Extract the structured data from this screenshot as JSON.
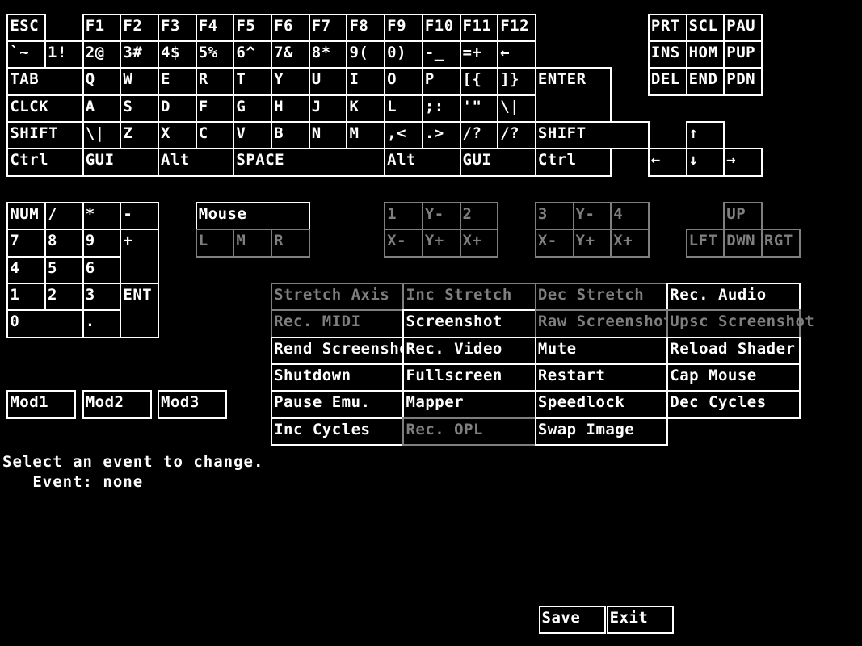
{
  "colors": {
    "enabled": "#FFFFFF",
    "disabled": "#7F7F7F",
    "background": "#000000"
  },
  "keyboard": {
    "keys": [
      {
        "label": "ESC",
        "c": 0,
        "r": 0,
        "w": 1,
        "h": 1
      },
      {
        "label": "F1",
        "c": 2,
        "r": 0,
        "w": 1,
        "h": 1
      },
      {
        "label": "F2",
        "c": 3,
        "r": 0,
        "w": 1,
        "h": 1
      },
      {
        "label": "F3",
        "c": 4,
        "r": 0,
        "w": 1,
        "h": 1
      },
      {
        "label": "F4",
        "c": 5,
        "r": 0,
        "w": 1,
        "h": 1
      },
      {
        "label": "F5",
        "c": 6,
        "r": 0,
        "w": 1,
        "h": 1
      },
      {
        "label": "F6",
        "c": 7,
        "r": 0,
        "w": 1,
        "h": 1
      },
      {
        "label": "F7",
        "c": 8,
        "r": 0,
        "w": 1,
        "h": 1
      },
      {
        "label": "F8",
        "c": 9,
        "r": 0,
        "w": 1,
        "h": 1
      },
      {
        "label": "F9",
        "c": 10,
        "r": 0,
        "w": 1,
        "h": 1
      },
      {
        "label": "F10",
        "c": 11,
        "r": 0,
        "w": 1,
        "h": 1
      },
      {
        "label": "F11",
        "c": 12,
        "r": 0,
        "w": 1,
        "h": 1
      },
      {
        "label": "F12",
        "c": 13,
        "r": 0,
        "w": 1,
        "h": 1
      },
      {
        "label": "`~",
        "c": 0,
        "r": 1,
        "w": 1,
        "h": 1
      },
      {
        "label": "1!",
        "c": 1,
        "r": 1,
        "w": 1,
        "h": 1
      },
      {
        "label": "2@",
        "c": 2,
        "r": 1,
        "w": 1,
        "h": 1
      },
      {
        "label": "3#",
        "c": 3,
        "r": 1,
        "w": 1,
        "h": 1
      },
      {
        "label": "4$",
        "c": 4,
        "r": 1,
        "w": 1,
        "h": 1
      },
      {
        "label": "5%",
        "c": 5,
        "r": 1,
        "w": 1,
        "h": 1
      },
      {
        "label": "6^",
        "c": 6,
        "r": 1,
        "w": 1,
        "h": 1
      },
      {
        "label": "7&",
        "c": 7,
        "r": 1,
        "w": 1,
        "h": 1
      },
      {
        "label": "8*",
        "c": 8,
        "r": 1,
        "w": 1,
        "h": 1
      },
      {
        "label": "9(",
        "c": 9,
        "r": 1,
        "w": 1,
        "h": 1
      },
      {
        "label": "0)",
        "c": 10,
        "r": 1,
        "w": 1,
        "h": 1
      },
      {
        "label": "-_",
        "c": 11,
        "r": 1,
        "w": 1,
        "h": 1
      },
      {
        "label": "=+",
        "c": 12,
        "r": 1,
        "w": 1,
        "h": 1
      },
      {
        "label": "←",
        "c": 13,
        "r": 1,
        "w": 1,
        "h": 1
      },
      {
        "label": "TAB",
        "c": 0,
        "r": 2,
        "w": 2,
        "h": 1
      },
      {
        "label": "Q",
        "c": 2,
        "r": 2,
        "w": 1,
        "h": 1
      },
      {
        "label": "W",
        "c": 3,
        "r": 2,
        "w": 1,
        "h": 1
      },
      {
        "label": "E",
        "c": 4,
        "r": 2,
        "w": 1,
        "h": 1
      },
      {
        "label": "R",
        "c": 5,
        "r": 2,
        "w": 1,
        "h": 1
      },
      {
        "label": "T",
        "c": 6,
        "r": 2,
        "w": 1,
        "h": 1
      },
      {
        "label": "Y",
        "c": 7,
        "r": 2,
        "w": 1,
        "h": 1
      },
      {
        "label": "U",
        "c": 8,
        "r": 2,
        "w": 1,
        "h": 1
      },
      {
        "label": "I",
        "c": 9,
        "r": 2,
        "w": 1,
        "h": 1
      },
      {
        "label": "O",
        "c": 10,
        "r": 2,
        "w": 1,
        "h": 1
      },
      {
        "label": "P",
        "c": 11,
        "r": 2,
        "w": 1,
        "h": 1
      },
      {
        "label": "[{",
        "c": 12,
        "r": 2,
        "w": 1,
        "h": 1
      },
      {
        "label": "]}",
        "c": 13,
        "r": 2,
        "w": 1,
        "h": 1
      },
      {
        "label": "ENTER",
        "c": 14,
        "r": 2,
        "w": 2,
        "h": 2
      },
      {
        "label": "CLCK",
        "c": 0,
        "r": 3,
        "w": 2,
        "h": 1
      },
      {
        "label": "A",
        "c": 2,
        "r": 3,
        "w": 1,
        "h": 1
      },
      {
        "label": "S",
        "c": 3,
        "r": 3,
        "w": 1,
        "h": 1
      },
      {
        "label": "D",
        "c": 4,
        "r": 3,
        "w": 1,
        "h": 1
      },
      {
        "label": "F",
        "c": 5,
        "r": 3,
        "w": 1,
        "h": 1
      },
      {
        "label": "G",
        "c": 6,
        "r": 3,
        "w": 1,
        "h": 1
      },
      {
        "label": "H",
        "c": 7,
        "r": 3,
        "w": 1,
        "h": 1
      },
      {
        "label": "J",
        "c": 8,
        "r": 3,
        "w": 1,
        "h": 1
      },
      {
        "label": "K",
        "c": 9,
        "r": 3,
        "w": 1,
        "h": 1
      },
      {
        "label": "L",
        "c": 10,
        "r": 3,
        "w": 1,
        "h": 1
      },
      {
        "label": ";:",
        "c": 11,
        "r": 3,
        "w": 1,
        "h": 1
      },
      {
        "label": "'\"",
        "c": 12,
        "r": 3,
        "w": 1,
        "h": 1
      },
      {
        "label": "\\|",
        "c": 13,
        "r": 3,
        "w": 1,
        "h": 1
      },
      {
        "label": "SHIFT",
        "c": 0,
        "r": 4,
        "w": 2,
        "h": 1
      },
      {
        "label": "\\|",
        "c": 2,
        "r": 4,
        "w": 1,
        "h": 1
      },
      {
        "label": "Z",
        "c": 3,
        "r": 4,
        "w": 1,
        "h": 1
      },
      {
        "label": "X",
        "c": 4,
        "r": 4,
        "w": 1,
        "h": 1
      },
      {
        "label": "C",
        "c": 5,
        "r": 4,
        "w": 1,
        "h": 1
      },
      {
        "label": "V",
        "c": 6,
        "r": 4,
        "w": 1,
        "h": 1
      },
      {
        "label": "B",
        "c": 7,
        "r": 4,
        "w": 1,
        "h": 1
      },
      {
        "label": "N",
        "c": 8,
        "r": 4,
        "w": 1,
        "h": 1
      },
      {
        "label": "M",
        "c": 9,
        "r": 4,
        "w": 1,
        "h": 1
      },
      {
        "label": ",<",
        "c": 10,
        "r": 4,
        "w": 1,
        "h": 1
      },
      {
        "label": ".>",
        "c": 11,
        "r": 4,
        "w": 1,
        "h": 1
      },
      {
        "label": "/?",
        "c": 12,
        "r": 4,
        "w": 1,
        "h": 1
      },
      {
        "label": "/?",
        "c": 13,
        "r": 4,
        "w": 1,
        "h": 1
      },
      {
        "label": "SHIFT",
        "c": 14,
        "r": 4,
        "w": 3,
        "h": 1
      },
      {
        "label": "Ctrl",
        "c": 0,
        "r": 5,
        "w": 2,
        "h": 1
      },
      {
        "label": "GUI",
        "c": 2,
        "r": 5,
        "w": 2,
        "h": 1
      },
      {
        "label": "Alt",
        "c": 4,
        "r": 5,
        "w": 2,
        "h": 1
      },
      {
        "label": "SPACE",
        "c": 6,
        "r": 5,
        "w": 4,
        "h": 1
      },
      {
        "label": "Alt",
        "c": 10,
        "r": 5,
        "w": 2,
        "h": 1
      },
      {
        "label": "GUI",
        "c": 12,
        "r": 5,
        "w": 2,
        "h": 1
      },
      {
        "label": "Ctrl",
        "c": 14,
        "r": 5,
        "w": 2,
        "h": 1
      },
      {
        "label": "PRT",
        "c": 17,
        "r": 0,
        "w": 1,
        "h": 1
      },
      {
        "label": "SCL",
        "c": 18,
        "r": 0,
        "w": 1,
        "h": 1
      },
      {
        "label": "PAU",
        "c": 19,
        "r": 0,
        "w": 1,
        "h": 1
      },
      {
        "label": "INS",
        "c": 17,
        "r": 1,
        "w": 1,
        "h": 1
      },
      {
        "label": "HOM",
        "c": 18,
        "r": 1,
        "w": 1,
        "h": 1
      },
      {
        "label": "PUP",
        "c": 19,
        "r": 1,
        "w": 1,
        "h": 1
      },
      {
        "label": "DEL",
        "c": 17,
        "r": 2,
        "w": 1,
        "h": 1
      },
      {
        "label": "END",
        "c": 18,
        "r": 2,
        "w": 1,
        "h": 1
      },
      {
        "label": "PDN",
        "c": 19,
        "r": 2,
        "w": 1,
        "h": 1
      },
      {
        "label": "↑",
        "c": 18,
        "r": 4,
        "w": 1,
        "h": 1
      },
      {
        "label": "←",
        "c": 17,
        "r": 5,
        "w": 1,
        "h": 1
      },
      {
        "label": "↓",
        "c": 18,
        "r": 5,
        "w": 1,
        "h": 1
      },
      {
        "label": "→",
        "c": 19,
        "r": 5,
        "w": 1,
        "h": 1
      }
    ]
  },
  "numpad": {
    "keys": [
      {
        "label": "NUM",
        "c": 0,
        "r": 7,
        "w": 1,
        "h": 1
      },
      {
        "label": "/",
        "c": 1,
        "r": 7,
        "w": 1,
        "h": 1
      },
      {
        "label": "*",
        "c": 2,
        "r": 7,
        "w": 1,
        "h": 1
      },
      {
        "label": "-",
        "c": 3,
        "r": 7,
        "w": 1,
        "h": 1
      },
      {
        "label": "7",
        "c": 0,
        "r": 8,
        "w": 1,
        "h": 1
      },
      {
        "label": "8",
        "c": 1,
        "r": 8,
        "w": 1,
        "h": 1
      },
      {
        "label": "9",
        "c": 2,
        "r": 8,
        "w": 1,
        "h": 1
      },
      {
        "label": "+",
        "c": 3,
        "r": 8,
        "w": 1,
        "h": 2
      },
      {
        "label": "4",
        "c": 0,
        "r": 9,
        "w": 1,
        "h": 1
      },
      {
        "label": "5",
        "c": 1,
        "r": 9,
        "w": 1,
        "h": 1
      },
      {
        "label": "6",
        "c": 2,
        "r": 9,
        "w": 1,
        "h": 1
      },
      {
        "label": "1",
        "c": 0,
        "r": 10,
        "w": 1,
        "h": 1
      },
      {
        "label": "2",
        "c": 1,
        "r": 10,
        "w": 1,
        "h": 1
      },
      {
        "label": "3",
        "c": 2,
        "r": 10,
        "w": 1,
        "h": 1
      },
      {
        "label": "ENT",
        "c": 3,
        "r": 10,
        "w": 1,
        "h": 2
      },
      {
        "label": "0",
        "c": 0,
        "r": 11,
        "w": 2,
        "h": 1
      },
      {
        "label": ".",
        "c": 2,
        "r": 11,
        "w": 1,
        "h": 1
      }
    ]
  },
  "mouse": {
    "keys": [
      {
        "label": "Mouse",
        "c": 5,
        "r": 7,
        "w": 3,
        "h": 1
      },
      {
        "label": "L",
        "c": 5,
        "r": 8,
        "w": 1,
        "h": 1,
        "disabled": true
      },
      {
        "label": "M",
        "c": 6,
        "r": 8,
        "w": 1,
        "h": 1,
        "disabled": true
      },
      {
        "label": "R",
        "c": 7,
        "r": 8,
        "w": 1,
        "h": 1,
        "disabled": true
      }
    ]
  },
  "joysticks": {
    "keys": [
      {
        "label": "1",
        "c": 10,
        "r": 7,
        "w": 1,
        "h": 1,
        "disabled": true
      },
      {
        "label": "Y-",
        "c": 11,
        "r": 7,
        "w": 1,
        "h": 1,
        "disabled": true
      },
      {
        "label": "2",
        "c": 12,
        "r": 7,
        "w": 1,
        "h": 1,
        "disabled": true
      },
      {
        "label": "X-",
        "c": 10,
        "r": 8,
        "w": 1,
        "h": 1,
        "disabled": true
      },
      {
        "label": "Y+",
        "c": 11,
        "r": 8,
        "w": 1,
        "h": 1,
        "disabled": true
      },
      {
        "label": "X+",
        "c": 12,
        "r": 8,
        "w": 1,
        "h": 1,
        "disabled": true
      },
      {
        "label": "3",
        "c": 14,
        "r": 7,
        "w": 1,
        "h": 1,
        "disabled": true
      },
      {
        "label": "Y-",
        "c": 15,
        "r": 7,
        "w": 1,
        "h": 1,
        "disabled": true
      },
      {
        "label": "4",
        "c": 16,
        "r": 7,
        "w": 1,
        "h": 1,
        "disabled": true
      },
      {
        "label": "X-",
        "c": 14,
        "r": 8,
        "w": 1,
        "h": 1,
        "disabled": true
      },
      {
        "label": "Y+",
        "c": 15,
        "r": 8,
        "w": 1,
        "h": 1,
        "disabled": true
      },
      {
        "label": "X+",
        "c": 16,
        "r": 8,
        "w": 1,
        "h": 1,
        "disabled": true
      },
      {
        "label": "UP",
        "c": 19,
        "r": 7,
        "w": 1,
        "h": 1,
        "disabled": true
      },
      {
        "label": "LFT",
        "c": 18,
        "r": 8,
        "w": 1,
        "h": 1,
        "disabled": true
      },
      {
        "label": "DWN",
        "c": 19,
        "r": 8,
        "w": 1,
        "h": 1,
        "disabled": true
      },
      {
        "label": "RGT",
        "c": 20,
        "r": 8,
        "w": 1,
        "h": 1,
        "disabled": true
      }
    ]
  },
  "handlers": {
    "keys": [
      {
        "label": "Stretch Axis",
        "c": 7,
        "r": 10,
        "w": 3.5,
        "h": 1,
        "disabled": true
      },
      {
        "label": "Inc Stretch",
        "c": 10.5,
        "r": 10,
        "w": 3.5,
        "h": 1,
        "disabled": true
      },
      {
        "label": "Dec Stretch",
        "c": 14,
        "r": 10,
        "w": 3.5,
        "h": 1,
        "disabled": true
      },
      {
        "label": "Rec. Audio",
        "c": 17.5,
        "r": 10,
        "w": 3.5,
        "h": 1
      },
      {
        "label": "Rec. MIDI",
        "c": 7,
        "r": 11,
        "w": 3.5,
        "h": 1,
        "disabled": true
      },
      {
        "label": "Screenshot",
        "c": 10.5,
        "r": 11,
        "w": 3.5,
        "h": 1
      },
      {
        "label": "Raw Screenshot",
        "c": 14,
        "r": 11,
        "w": 3.5,
        "h": 1,
        "disabled": true
      },
      {
        "label": "Upsc Screenshot",
        "c": 17.5,
        "r": 11,
        "w": 3.5,
        "h": 1,
        "disabled": true
      },
      {
        "label": "Rend Screenshot",
        "c": 7,
        "r": 12,
        "w": 3.5,
        "h": 1
      },
      {
        "label": "Rec. Video",
        "c": 10.5,
        "r": 12,
        "w": 3.5,
        "h": 1
      },
      {
        "label": "Mute",
        "c": 14,
        "r": 12,
        "w": 3.5,
        "h": 1
      },
      {
        "label": "Reload Shader",
        "c": 17.5,
        "r": 12,
        "w": 3.5,
        "h": 1
      },
      {
        "label": "Shutdown",
        "c": 7,
        "r": 13,
        "w": 3.5,
        "h": 1
      },
      {
        "label": "Fullscreen",
        "c": 10.5,
        "r": 13,
        "w": 3.5,
        "h": 1
      },
      {
        "label": "Restart",
        "c": 14,
        "r": 13,
        "w": 3.5,
        "h": 1
      },
      {
        "label": "Cap Mouse",
        "c": 17.5,
        "r": 13,
        "w": 3.5,
        "h": 1
      },
      {
        "label": "Pause Emu.",
        "c": 7,
        "r": 14,
        "w": 3.5,
        "h": 1
      },
      {
        "label": "Mapper",
        "c": 10.5,
        "r": 14,
        "w": 3.5,
        "h": 1
      },
      {
        "label": "Speedlock",
        "c": 14,
        "r": 14,
        "w": 3.5,
        "h": 1
      },
      {
        "label": "Dec Cycles",
        "c": 17.5,
        "r": 14,
        "w": 3.5,
        "h": 1
      },
      {
        "label": "Inc Cycles",
        "c": 7,
        "r": 15,
        "w": 3.5,
        "h": 1
      },
      {
        "label": "Rec. OPL",
        "c": 10.5,
        "r": 15,
        "w": 3.5,
        "h": 1,
        "disabled": true
      },
      {
        "label": "Swap Image",
        "c": 14,
        "r": 15,
        "w": 3.5,
        "h": 1
      }
    ]
  },
  "modifiers": {
    "keys": [
      {
        "label": "Mod1",
        "c": 0,
        "r": 14,
        "w": 1.8,
        "h": 1
      },
      {
        "label": "Mod2",
        "c": 2,
        "r": 14,
        "w": 1.8,
        "h": 1
      },
      {
        "label": "Mod3",
        "c": 4,
        "r": 14,
        "w": 1.8,
        "h": 1
      }
    ]
  },
  "status": {
    "line1": "Select an event to change.",
    "line2": "   Event: none"
  },
  "actions": {
    "keys": [
      {
        "label": "Save",
        "c": 14.1,
        "r": 22,
        "w": 1.75,
        "h": 1
      },
      {
        "label": "Exit",
        "c": 15.9,
        "r": 22,
        "w": 1.75,
        "h": 1
      }
    ]
  }
}
